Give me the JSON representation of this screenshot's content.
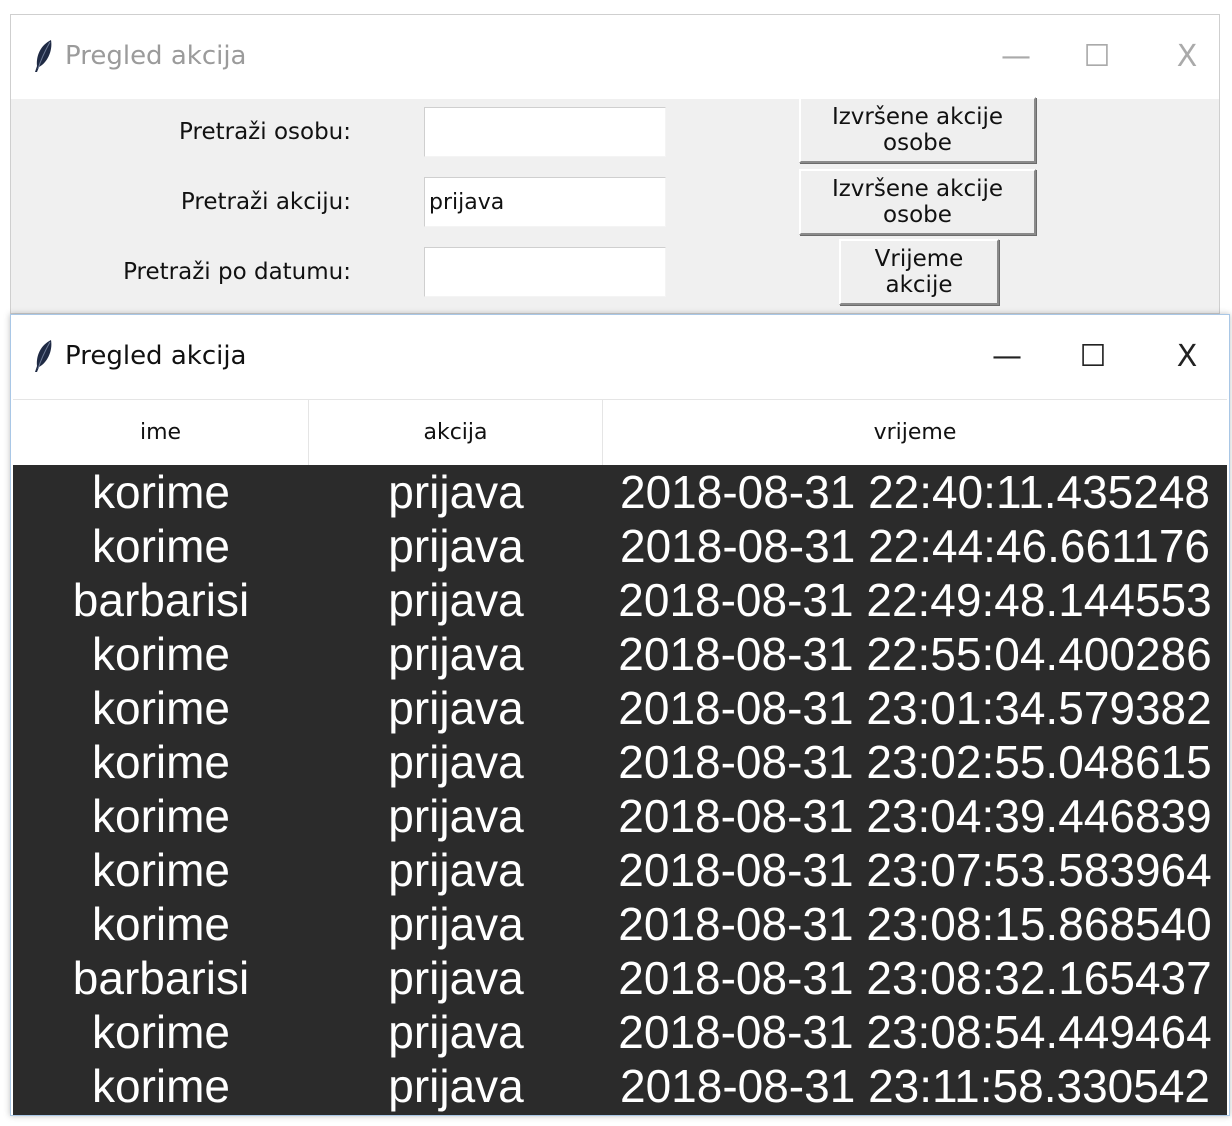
{
  "back_window": {
    "title": "Pregled akcija",
    "controls": {
      "minimize": "—",
      "maximize": "☐",
      "close": "X"
    },
    "form": {
      "person_label": "Pretraži osobu:",
      "person_value": "",
      "action_label": "Pretraži akciju:",
      "action_value": "prijava",
      "date_label": "Pretraži po datumu:",
      "date_value": "",
      "button1_label": "Izvršene akcije osobe",
      "button2_label": "Izvršene akcije osobe",
      "button3_label": "Vrijeme akcije"
    }
  },
  "front_window": {
    "title": "Pregled akcija",
    "controls": {
      "minimize": "—",
      "maximize": "☐",
      "close": "X"
    },
    "table": {
      "columns": [
        "ime",
        "akcija",
        "vrijeme"
      ],
      "rows": [
        [
          "korime",
          "prijava",
          "2018-08-31 22:40:11.435248"
        ],
        [
          "korime",
          "prijava",
          "2018-08-31 22:44:46.661176"
        ],
        [
          "barbarisi",
          "prijava",
          "2018-08-31 22:49:48.144553"
        ],
        [
          "korime",
          "prijava",
          "2018-08-31 22:55:04.400286"
        ],
        [
          "korime",
          "prijava",
          "2018-08-31 23:01:34.579382"
        ],
        [
          "korime",
          "prijava",
          "2018-08-31 23:02:55.048615"
        ],
        [
          "korime",
          "prijava",
          "2018-08-31 23:04:39.446839"
        ],
        [
          "korime",
          "prijava",
          "2018-08-31 23:07:53.583964"
        ],
        [
          "korime",
          "prijava",
          "2018-08-31 23:08:15.868540"
        ],
        [
          "barbarisi",
          "prijava",
          "2018-08-31 23:08:32.165437"
        ],
        [
          "korime",
          "prijava",
          "2018-08-31 23:08:54.449464"
        ],
        [
          "korime",
          "prijava",
          "2018-08-31 23:11:58.330542"
        ]
      ]
    }
  },
  "icons": {
    "app": "feather-icon"
  },
  "colors": {
    "table_bg": "#2b2b2b",
    "table_fg": "#ffffff",
    "window_bg": "#f0f0f0"
  }
}
